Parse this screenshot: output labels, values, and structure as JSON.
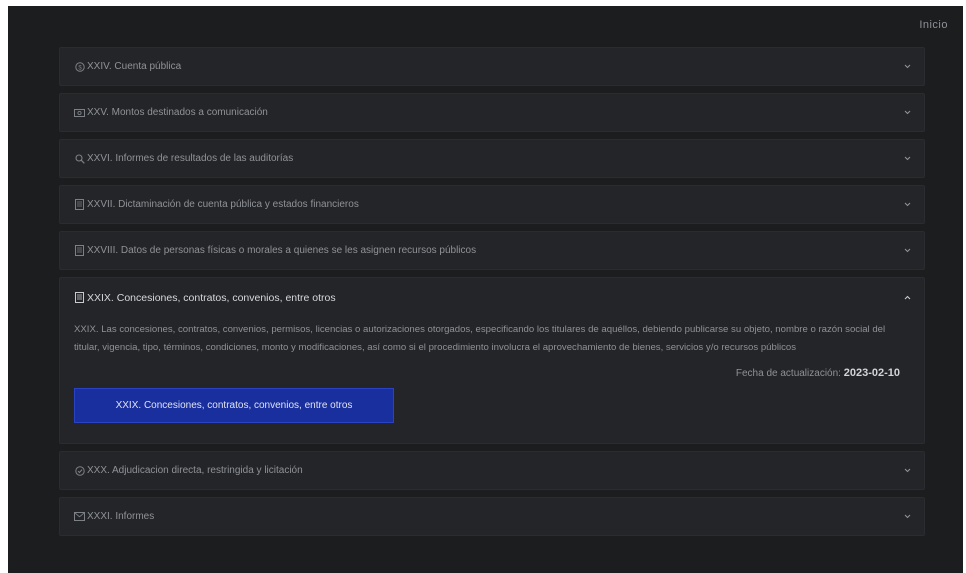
{
  "nav": {
    "home_label": "Inicio"
  },
  "accordion": {
    "items": [
      {
        "label": "XXIV. Cuenta pública",
        "icon": "coin-icon"
      },
      {
        "label": "XXV. Montos destinados a comunicación",
        "icon": "money-icon"
      },
      {
        "label": "XXVI. Informes de resultados de las auditorías",
        "icon": "search-icon"
      },
      {
        "label": "XXVII. Dictaminación de cuenta pública y estados financieros",
        "icon": "document-icon"
      },
      {
        "label": "XXVIII. Datos de personas físicas o morales a quienes se les asignen recursos públicos",
        "icon": "document-icon"
      },
      {
        "label": "XXIX. Concesiones, contratos, convenios, entre otros",
        "icon": "document-icon",
        "expanded": true,
        "description": "XXIX. Las concesiones, contratos, convenios, permisos, licencias o autorizaciones otorgados, especificando los titulares de aquéllos, debiendo publicarse su objeto, nombre o razón social del titular, vigencia, tipo, términos, condiciones, monto y modificaciones, así como si el procedimiento involucra el aprovechamiento de bienes, servicios y/o recursos públicos",
        "date_label": "Fecha de actualización: ",
        "date_value": "2023-02-10",
        "button_label": "XXIX. Concesiones, contratos, convenios, entre otros"
      },
      {
        "label": "XXX. Adjudicacion directa, restringida y licitación",
        "icon": "check-circle-icon"
      },
      {
        "label": "XXXI. Informes",
        "icon": "mail-icon"
      }
    ]
  },
  "colors": {
    "background": "#1c1d1f",
    "panel": "#242528",
    "button": "#1a2f9e",
    "text_muted": "#8f9297"
  }
}
